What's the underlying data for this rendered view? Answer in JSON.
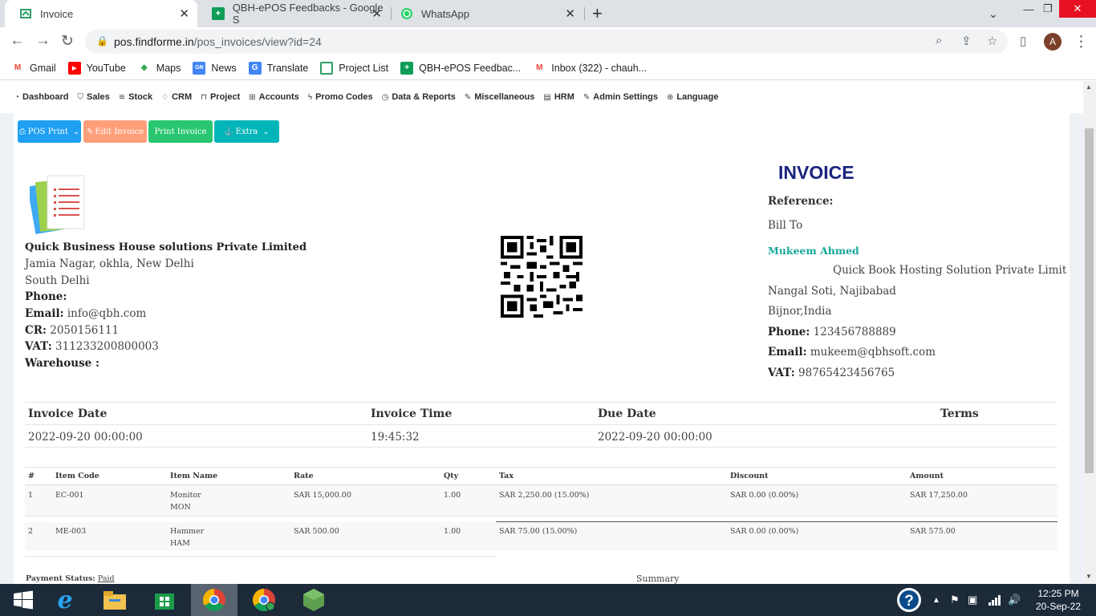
{
  "browser": {
    "tabs": [
      {
        "title": "Invoice",
        "icon": "invoice-favicon"
      },
      {
        "title": "QBH-ePOS Feedbacks - Google S",
        "icon": "sheets-icon"
      },
      {
        "title": "WhatsApp",
        "icon": "whatsapp-icon"
      }
    ],
    "url_host": "pos.findforme.in",
    "url_path": "/pos_invoices/view?id=24",
    "avatar_letter": "A",
    "bookmarks": [
      {
        "label": "Gmail",
        "icon": "gmail-icon"
      },
      {
        "label": "YouTube",
        "icon": "youtube-icon"
      },
      {
        "label": "Maps",
        "icon": "maps-icon"
      },
      {
        "label": "News",
        "icon": "news-icon"
      },
      {
        "label": "Translate",
        "icon": "translate-icon"
      },
      {
        "label": "Project List",
        "icon": "project-icon"
      },
      {
        "label": "QBH-ePOS Feedbac...",
        "icon": "sheets-icon"
      },
      {
        "label": "Inbox (322) - chauh...",
        "icon": "gmail-icon"
      }
    ]
  },
  "menu": [
    {
      "label": "Dashboard",
      "icon": "dashboard-icon"
    },
    {
      "label": "Sales",
      "icon": "cart-icon"
    },
    {
      "label": "Stock",
      "icon": "stack-icon"
    },
    {
      "label": "CRM",
      "icon": "diamond-icon"
    },
    {
      "label": "Project",
      "icon": "briefcase-icon"
    },
    {
      "label": "Accounts",
      "icon": "calculator-icon"
    },
    {
      "label": "Promo Codes",
      "icon": "bolt-icon"
    },
    {
      "label": "Data & Reports",
      "icon": "clock-icon"
    },
    {
      "label": "Miscellaneous",
      "icon": "edit-icon"
    },
    {
      "label": "HRM",
      "icon": "book-icon"
    },
    {
      "label": "Admin Settings",
      "icon": "edit-icon"
    },
    {
      "label": "Language",
      "icon": "globe-icon"
    }
  ],
  "actions": {
    "pos_print": "POS Print",
    "edit_invoice": "Edit Invoice",
    "print_invoice": "Print Invoice",
    "extra": "Extra"
  },
  "company": {
    "name": "Quick Business House solutions Private Limited",
    "address1": "Jamia Nagar, okhla, New Delhi",
    "address2": "South Delhi",
    "phone_label": "Phone:",
    "email_label": "Email:",
    "email": "info@qbh.com",
    "cr_label": "CR:",
    "cr": "2050156111",
    "vat_label": "VAT:",
    "vat": "311233200800003",
    "warehouse_label": "Warehouse :"
  },
  "invoice": {
    "title": "INVOICE",
    "reference_label": "Reference:",
    "bill_to": "Bill To",
    "customer_name": "Mukeem Ahmed",
    "customer_company": "Quick Book Hosting Solution Private Limit",
    "customer_address1": "Nangal Soti, Najibabad",
    "customer_address2": "Bijnor,India",
    "phone_label": "Phone:",
    "phone": "123456788889",
    "email_label": "Email:",
    "email": "mukeem@qbhsoft.com",
    "vat_label": "VAT:",
    "vat": "98765423456765"
  },
  "dates": {
    "headers": [
      "Invoice Date",
      "Invoice Time",
      "Due Date",
      "Terms"
    ],
    "values": [
      "2022-09-20 00:00:00",
      "19:45:32",
      "2022-09-20 00:00:00",
      ""
    ]
  },
  "items": {
    "headers": [
      "#",
      "Item Code",
      "Item Name",
      "Rate",
      "Qty",
      "Tax",
      "Discount",
      "Amount"
    ],
    "rows": [
      {
        "no": "1",
        "code": "EC-001",
        "name": "Monitor",
        "sub": "MON",
        "rate": "SAR 15,000.00",
        "qty": "1.00",
        "tax": "SAR 2,250.00 (15.00%)",
        "discount": "SAR 0.00 (0.00%)",
        "amount": "SAR 17,250.00"
      },
      {
        "no": "2",
        "code": "ME-003",
        "name": "Hammer",
        "sub": "HAM",
        "rate": "SAR 500.00",
        "qty": "1.00",
        "tax": "SAR 75.00 (15.00%)",
        "discount": "SAR 0.00 (0.00%)",
        "amount": "SAR 575.00"
      }
    ]
  },
  "payment": {
    "label": "Payment Status:",
    "status": "Paid",
    "summary": "Summary"
  },
  "taskbar": {
    "time": "12:25 PM",
    "date": "20-Sep-22"
  },
  "colors": {
    "btn_pos": "#1e9ff2",
    "btn_edit": "#ff9f7a",
    "btn_print": "#28c76f",
    "btn_extra": "#00b5b8",
    "invoice_title": "#1a237e",
    "customer_name": "#16a69a"
  }
}
